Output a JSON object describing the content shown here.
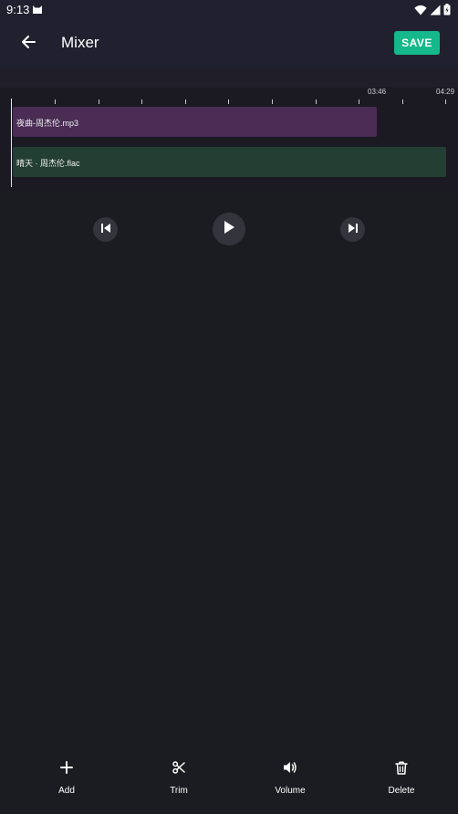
{
  "status_bar": {
    "time": "9:13",
    "icons": [
      "cat-icon",
      "wifi-icon",
      "signal-icon",
      "battery-icon"
    ]
  },
  "app_bar": {
    "title": "Mixer",
    "save_label": "SAVE",
    "save_color": "#14b88a"
  },
  "timeline": {
    "markers": [
      "03:46",
      "04:29"
    ],
    "tracks": [
      {
        "name": "夜曲-周杰伦.mp3",
        "color": "#4a2c55"
      },
      {
        "name": "晴天 · 周杰伦.flac",
        "color": "#233f33"
      }
    ]
  },
  "playback": {
    "icons": [
      "skip-previous-icon",
      "play-icon",
      "skip-next-icon"
    ]
  },
  "bottom_nav": {
    "items": [
      {
        "label": "Add",
        "icon": "plus-icon"
      },
      {
        "label": "Trim",
        "icon": "scissors-icon"
      },
      {
        "label": "Volume",
        "icon": "volume-icon"
      },
      {
        "label": "Delete",
        "icon": "trash-icon"
      }
    ]
  }
}
